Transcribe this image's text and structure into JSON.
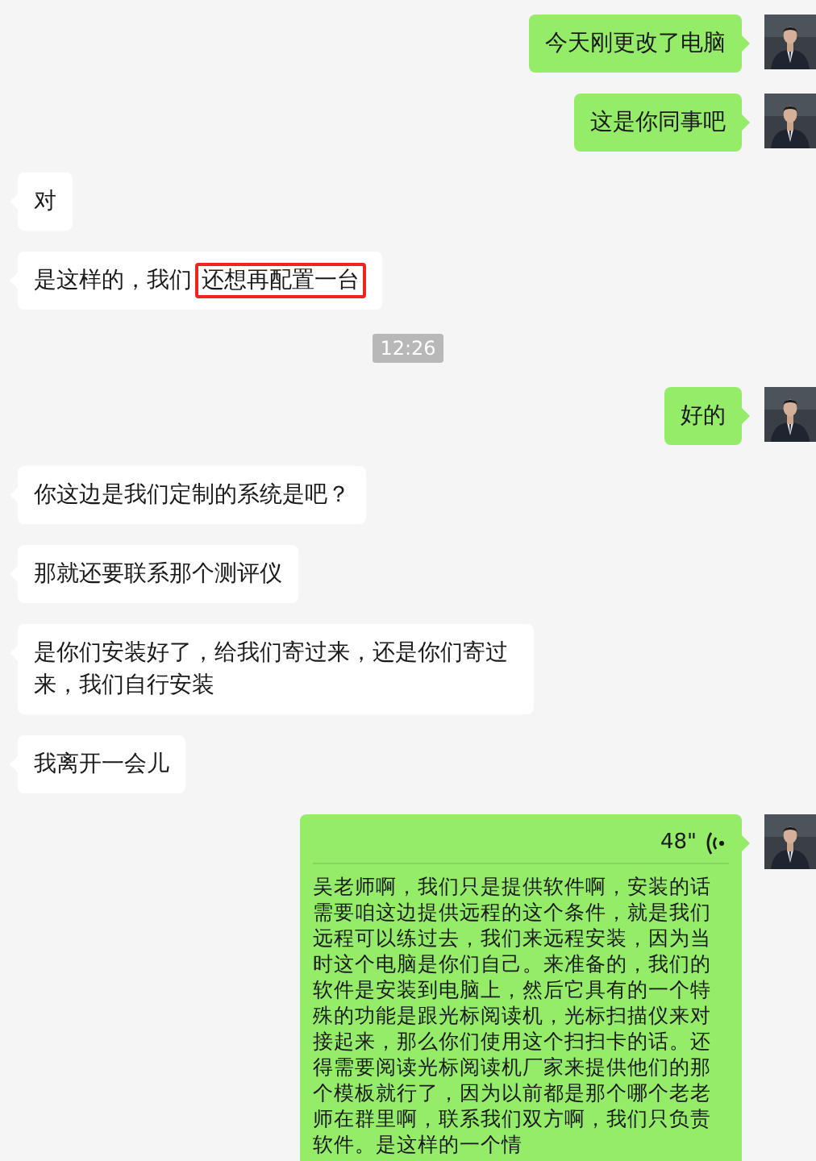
{
  "messages": [
    {
      "kind": "text",
      "outgoing": true,
      "text": "今天刚更改了电脑"
    },
    {
      "kind": "text",
      "outgoing": true,
      "text": "这是你同事吧"
    },
    {
      "kind": "text",
      "outgoing": false,
      "text": "对"
    },
    {
      "kind": "text",
      "outgoing": false,
      "text": "是这样的，我们",
      "highlight": "还想再配置一台"
    },
    {
      "kind": "time",
      "text": "12:26"
    },
    {
      "kind": "text",
      "outgoing": true,
      "text": "好的"
    },
    {
      "kind": "text",
      "outgoing": false,
      "text": "你这边是我们定制的系统是吧？"
    },
    {
      "kind": "text",
      "outgoing": false,
      "text": "那就还要联系那个测评仪"
    },
    {
      "kind": "text",
      "outgoing": false,
      "text": "是你们安装好了，给我们寄过来，还是你们寄过来，我们自行安装"
    },
    {
      "kind": "text",
      "outgoing": false,
      "text": "我离开一会儿"
    },
    {
      "kind": "voice",
      "outgoing": true,
      "duration": "48\"",
      "transcript": "吴老师啊，我们只是提供软件啊，安装的话需要咱这边提供远程的这个条件，就是我们远程可以练过去，我们来远程安装，因为当时这个电脑是你们自己。来准备的，我们的软件是安装到电脑上，然后它具有的一个特殊的功能是跟光标阅读机，光标扫描仪来对接起来，那么你们使用这个扫扫卡的话。还得需要阅读光标阅读机厂家来提供他们的那个模板就行了，因为以前都是那个哪个老老师在群里啊，联系我们双方啊，我们只负责软件。是这样的一个情"
    }
  ]
}
